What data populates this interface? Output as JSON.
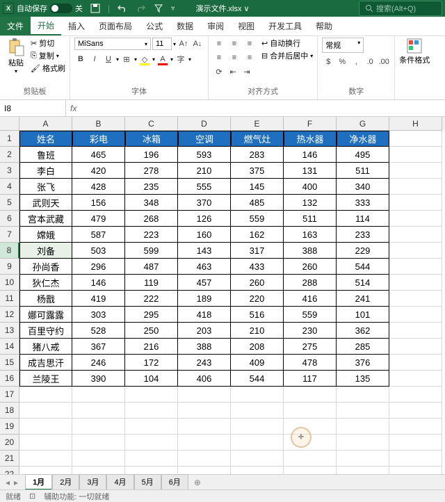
{
  "titlebar": {
    "autosave_label": "自动保存",
    "autosave_state": "关",
    "filename": "演示文件.xlsx ∨",
    "search_placeholder": "搜索(Alt+Q)"
  },
  "menu": {
    "file": "文件",
    "home": "开始",
    "insert": "插入",
    "layout": "页面布局",
    "formulas": "公式",
    "data": "数据",
    "review": "审阅",
    "view": "视图",
    "developer": "开发工具",
    "help": "帮助"
  },
  "ribbon": {
    "paste": "粘贴",
    "cut": "剪切",
    "copy": "复制",
    "format_painter": "格式刷",
    "clipboard_group": "剪贴板",
    "font_name": "MiSans",
    "font_size": "11",
    "font_group": "字体",
    "wrap": "自动换行",
    "merge": "合并后居中",
    "align_group": "对齐方式",
    "number_format": "常规",
    "number_group": "数字",
    "cond_format": "条件格式"
  },
  "namebox": "I8",
  "columns": [
    "A",
    "B",
    "C",
    "D",
    "E",
    "F",
    "G",
    "H"
  ],
  "rows": [
    "1",
    "2",
    "3",
    "4",
    "5",
    "6",
    "7",
    "8",
    "9",
    "10",
    "11",
    "12",
    "13",
    "14",
    "15",
    "16",
    "17",
    "18",
    "19",
    "20",
    "21",
    "22"
  ],
  "active_row": 8,
  "table": {
    "headers": [
      "姓名",
      "彩电",
      "冰箱",
      "空调",
      "燃气灶",
      "热水器",
      "净水器"
    ],
    "data": [
      [
        "鲁班",
        465,
        196,
        593,
        283,
        146,
        495
      ],
      [
        "李白",
        420,
        278,
        210,
        375,
        131,
        511
      ],
      [
        "张飞",
        428,
        235,
        555,
        145,
        400,
        340
      ],
      [
        "武则天",
        156,
        348,
        370,
        485,
        132,
        333
      ],
      [
        "宫本武藏",
        479,
        268,
        126,
        559,
        511,
        114
      ],
      [
        "嫦娥",
        587,
        223,
        160,
        162,
        163,
        233
      ],
      [
        "刘备",
        503,
        599,
        143,
        317,
        388,
        229
      ],
      [
        "孙尚香",
        296,
        487,
        463,
        433,
        260,
        544
      ],
      [
        "狄仁杰",
        146,
        119,
        457,
        260,
        288,
        514
      ],
      [
        "杨戬",
        419,
        222,
        189,
        220,
        416,
        241
      ],
      [
        "娜可露露",
        303,
        295,
        418,
        516,
        559,
        101
      ],
      [
        "百里守约",
        528,
        250,
        203,
        210,
        230,
        362
      ],
      [
        "猪八戒",
        367,
        216,
        388,
        208,
        275,
        285
      ],
      [
        "成吉思汗",
        246,
        172,
        243,
        409,
        478,
        376
      ],
      [
        "兰陵王",
        390,
        104,
        406,
        544,
        117,
        135
      ]
    ]
  },
  "sheets": [
    "1月",
    "2月",
    "3月",
    "4月",
    "5月",
    "6月"
  ],
  "active_sheet": 0,
  "statusbar": {
    "ready": "就绪",
    "access": "辅助功能: 一切就绪"
  }
}
